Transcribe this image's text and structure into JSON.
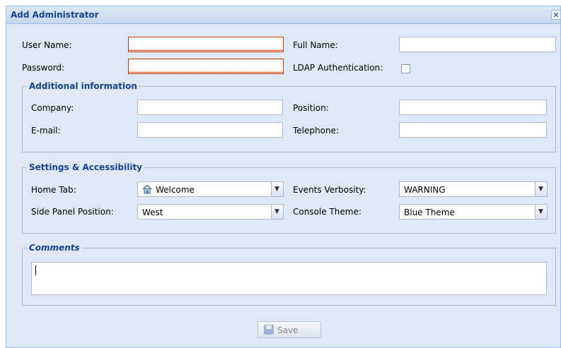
{
  "window": {
    "title": "Add Administrator",
    "close_glyph": "✕"
  },
  "account": {
    "user_name_label": "User Name:",
    "full_name_label": "Full Name:",
    "password_label": "Password:",
    "ldap_label": "LDAP Authentication:",
    "user_name_value": "",
    "full_name_value": "",
    "password_value": "",
    "ldap_checked": false
  },
  "additional": {
    "legend": "Additional information",
    "company_label": "Company:",
    "position_label": "Position:",
    "email_label": "E-mail:",
    "telephone_label": "Telephone:"
  },
  "settings": {
    "legend": "Settings & Accessibility",
    "home_tab_label": "Home Tab:",
    "home_tab_value": "Welcome",
    "home_tab_icon": "home-icon",
    "events_label": "Events Verbosity:",
    "events_value": "WARNING",
    "side_panel_label": "Side Panel Position:",
    "side_panel_value": "West",
    "theme_label": "Console Theme:",
    "theme_value": "Blue Theme"
  },
  "comments": {
    "legend": "Comments",
    "value": ""
  },
  "footer": {
    "save_label": "Save",
    "save_icon": "floppy-disk-icon"
  },
  "colors": {
    "window_bg": "#dfe8f6",
    "title_text": "#15428b",
    "invalid_border": "#cc3300"
  }
}
